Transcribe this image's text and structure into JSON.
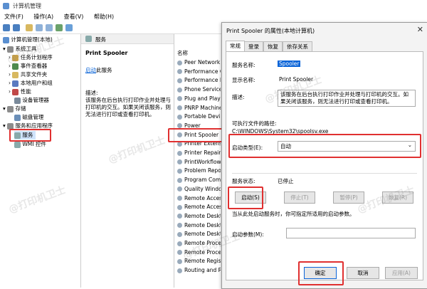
{
  "window": {
    "title": "计算机管理"
  },
  "menu": [
    "文件(F)",
    "操作(A)",
    "查看(V)",
    "帮助(H)"
  ],
  "tree": [
    "计算机管理(本地)",
    "系统工具",
    "任务计划程序",
    "事件查看器",
    "共享文件夹",
    "本地用户和组",
    "性能",
    "设备管理器",
    "存储",
    "磁盘管理",
    "服务和应用程序",
    "服务",
    "WMI 控件"
  ],
  "middle": {
    "header": "服务",
    "name": "Print Spooler",
    "link": "启动",
    "link_suffix": "此服务",
    "desc_label": "描述:",
    "desc": "该服务在后台执行打印作业并处理与打印机的交互。如果关闭该服务，则无法进行打印或查看打印机。"
  },
  "list": {
    "header": "名称",
    "items": [
      "Peer Network",
      "Performance C",
      "Performance L",
      "Phone Service",
      "Plug and Play",
      "PNRP Machine",
      "Portable Devi",
      "Power",
      "Print Spooler",
      "Printer Extensi",
      "Printer Repair",
      "PrintWorkflow",
      "Problem Repor",
      "Program Com",
      "Quality Windo",
      "Remote Acces",
      "Remote Acces",
      "Remote Deskt",
      "Remote Deskt",
      "Remote Deskt",
      "Remote Proce",
      "Remote Proce",
      "Remote Regis",
      "Routing and R"
    ]
  },
  "dialog": {
    "title": "Print Spooler 的属性(本地计算机)",
    "close": "✕",
    "tabs": [
      "常规",
      "登录",
      "恢复",
      "依存关系"
    ],
    "service_name_label": "服务名称:",
    "service_name": "Spooler",
    "display_name_label": "显示名称:",
    "display_name": "Print Spooler",
    "desc_label": "描述:",
    "desc": "该服务在后台执行打印作业并处理与打印机的交互。如果关闭该服务，则无法进行打印或查看打印机。",
    "path_label": "可执行文件的路径:",
    "path": "C:\\WINDOWS\\System32\\spoolsv.exe",
    "startup_label": "启动类型(E):",
    "startup_value": "自动",
    "status_label": "服务状态:",
    "status_value": "已停止",
    "buttons": {
      "start": "启动(S)",
      "stop": "停止(T)",
      "pause": "暂停(P)",
      "resume": "恢复(R)"
    },
    "hint": "当从此处启动服务时，你可指定所适用的启动参数。",
    "params_label": "启动参数(M):",
    "ok": "确定",
    "cancel": "取消",
    "apply": "应用(A)"
  },
  "watermarks": [
    "@打印机卫士",
    "@打印机卫士",
    "@打印机卫士",
    "@打印机卫士",
    "@打印机卫士",
    "@打印机卫士"
  ],
  "colors": {
    "highlight": "#e03030",
    "selected": "#0a64d8"
  }
}
